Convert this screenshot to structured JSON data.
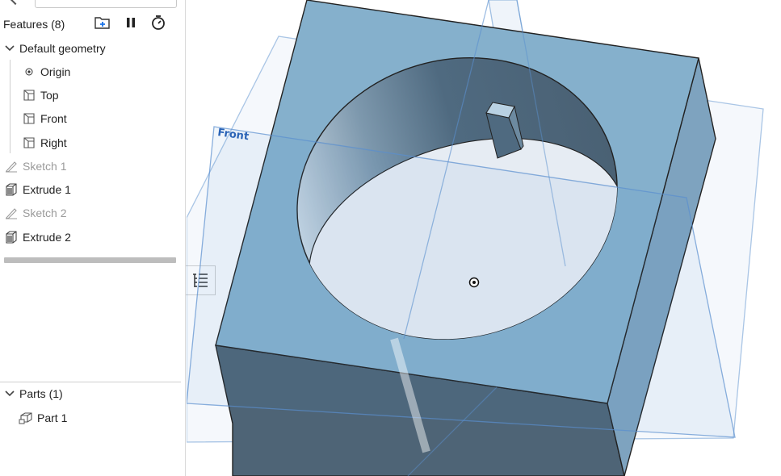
{
  "features": {
    "title": "Features (8)",
    "toolbar": [
      "add-folder-icon",
      "pause-icon",
      "timer-icon"
    ],
    "default_geometry": {
      "label": "Default geometry",
      "items": [
        {
          "icon": "origin-icon",
          "label": "Origin"
        },
        {
          "icon": "plane-icon",
          "label": "Top"
        },
        {
          "icon": "plane-icon",
          "label": "Front"
        },
        {
          "icon": "plane-icon",
          "label": "Right"
        }
      ]
    },
    "items": [
      {
        "icon": "sketch-icon",
        "label": "Sketch 1",
        "muted": true
      },
      {
        "icon": "extrude-icon",
        "label": "Extrude 1",
        "muted": false
      },
      {
        "icon": "sketch-icon",
        "label": "Sketch 2",
        "muted": true
      },
      {
        "icon": "extrude-icon",
        "label": "Extrude 2",
        "muted": false
      }
    ]
  },
  "parts": {
    "title": "Parts (1)",
    "items": [
      {
        "icon": "part-icon",
        "label": "Part 1"
      }
    ]
  },
  "viewport": {
    "plane_label": "Front",
    "colors": {
      "face_top": "#85b0cc",
      "face_side": "#4e6476",
      "face_right": "#7ea3bf",
      "hole_floor": "#e6ecf3",
      "plane": "#4d88c9"
    }
  }
}
